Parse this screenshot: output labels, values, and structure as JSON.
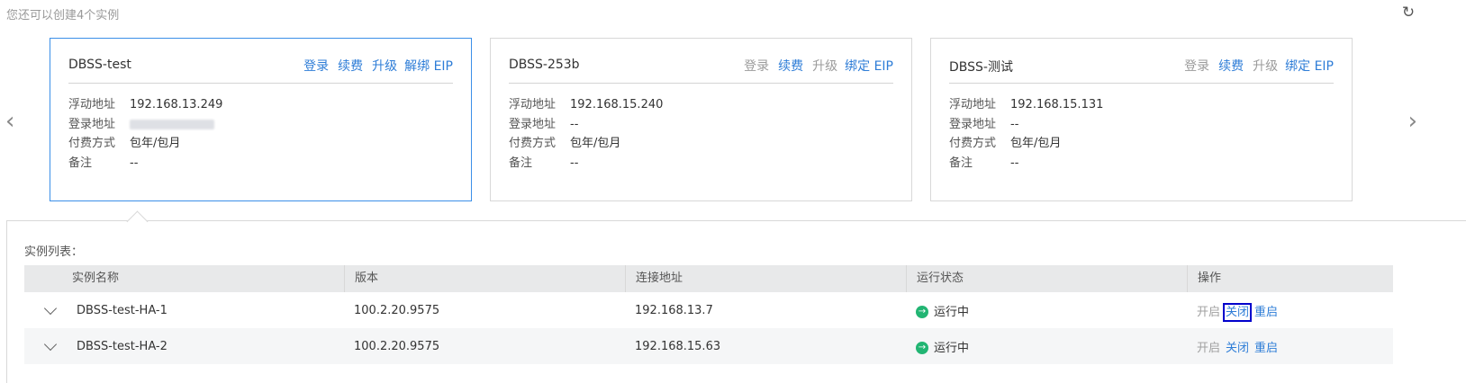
{
  "quota_text": "您还可以创建4个实例",
  "cards": [
    {
      "title": "DBSS-test",
      "actions": [
        "登录",
        "续费",
        "升级",
        "解绑 EIP"
      ],
      "fields": {
        "float_label": "浮动地址",
        "float_value": "192.168.13.249",
        "login_label": "登录地址",
        "login_value": "",
        "pay_label": "付费方式",
        "pay_value": "包年/包月",
        "note_label": "备注",
        "note_value": "--"
      }
    },
    {
      "title": "DBSS-253b",
      "actions": [
        "登录",
        "续费",
        "升级",
        "绑定 EIP"
      ],
      "fields": {
        "float_label": "浮动地址",
        "float_value": "192.168.15.240",
        "login_label": "登录地址",
        "login_value": "--",
        "pay_label": "付费方式",
        "pay_value": "包年/包月",
        "note_label": "备注",
        "note_value": "--"
      }
    },
    {
      "title": "DBSS-测试",
      "actions": [
        "登录",
        "续费",
        "升级",
        "绑定 EIP"
      ],
      "fields": {
        "float_label": "浮动地址",
        "float_value": "192.168.15.131",
        "login_label": "登录地址",
        "login_value": "--",
        "pay_label": "付费方式",
        "pay_value": "包年/包月",
        "note_label": "备注",
        "note_value": "--"
      }
    }
  ],
  "list": {
    "title": "实例列表：",
    "headers": [
      "实例名称",
      "版本",
      "连接地址",
      "运行状态",
      "操作"
    ],
    "rows": [
      {
        "name": "DBSS-test-HA-1",
        "version": "100.2.20.9575",
        "address": "192.168.13.7",
        "status": "运行中",
        "ops": [
          "开启",
          "关闭",
          "重启"
        ]
      },
      {
        "name": "DBSS-test-HA-2",
        "version": "100.2.20.9575",
        "address": "192.168.15.63",
        "status": "运行中",
        "ops": [
          "开启",
          "关闭",
          "重启"
        ]
      }
    ]
  },
  "colors": {
    "link": "#2e7dd7",
    "active_border": "#3b8fe8",
    "status_running": "#22b573",
    "focus_outline": "#0000cc"
  },
  "icons": [
    "refresh-icon",
    "chevron-left-icon",
    "chevron-right-icon",
    "expand-chevron-icon",
    "running-status-icon"
  ]
}
